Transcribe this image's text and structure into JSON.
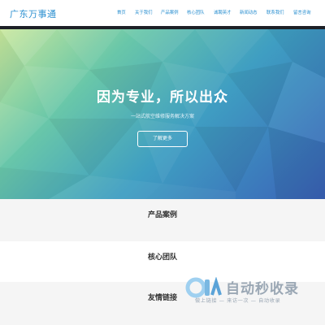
{
  "header": {
    "brand": "广东万事通",
    "nav": [
      "首页",
      "关于我们",
      "产品案例",
      "核心团队",
      "诚聘英才",
      "新闻动态",
      "联系我们",
      "留言咨询"
    ]
  },
  "hero": {
    "title": "因为专业，所以出众",
    "subtitle": "一站式航空维修服务解决方案",
    "button": "了解更多"
  },
  "sections": [
    "产品案例",
    "核心团队",
    "友情链接"
  ],
  "watermark": {
    "title": "自动秒收录",
    "subtitle": "做上链接 — 来访一次 — 自动收录"
  },
  "colors": {
    "accent": "#2a8fd0",
    "nav_border": "#1d2026",
    "section_alt": "#f5f5f5"
  }
}
